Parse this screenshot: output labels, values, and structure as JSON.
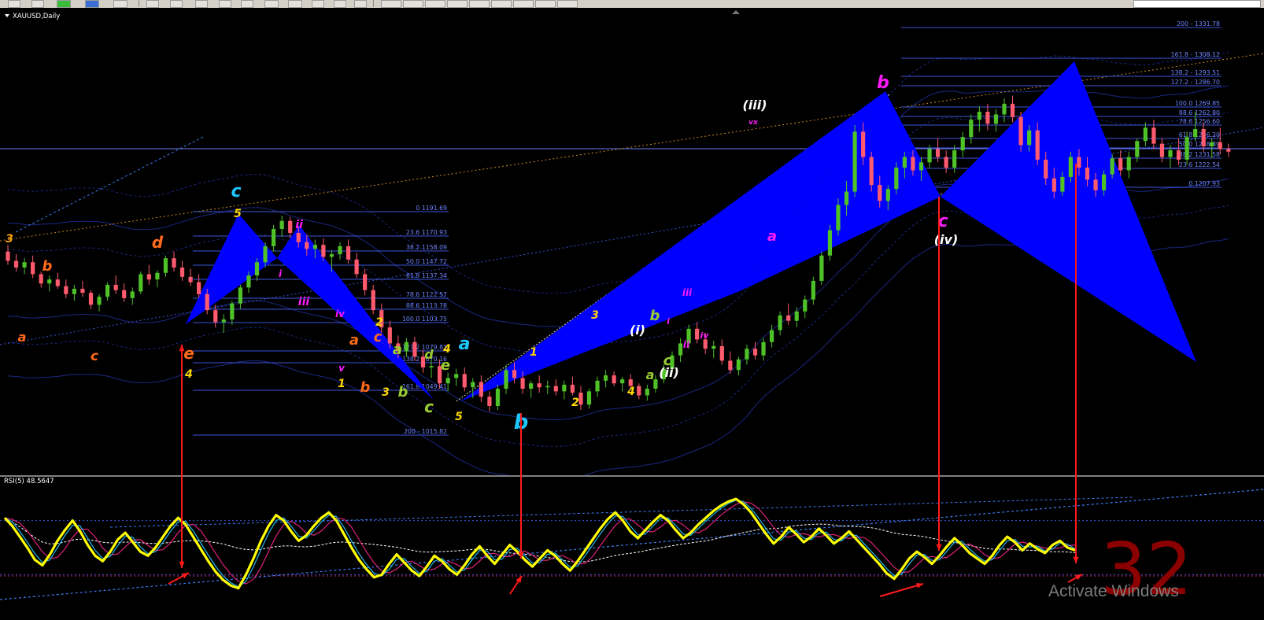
{
  "window": {
    "symbol_title": "XAUUSD,Daily"
  },
  "indicator": {
    "label": "RSI(5) 48.5647"
  },
  "watermark": {
    "text": "Activate Windows"
  },
  "annotation": {
    "count": "32"
  },
  "colors": {
    "background": "#000000",
    "bull": "#4ec227",
    "bear": "#ff5a6e",
    "pattern": "#0000ff",
    "fib": "#3c55d8",
    "rsi": "#ffff00",
    "arrow": "#ff1a1a"
  },
  "fib_left": {
    "levels": [
      {
        "label": "0 1191.69"
      },
      {
        "label": "23.6 1170.93"
      },
      {
        "label": "38.2 1158.09"
      },
      {
        "label": "50.0 1147.72"
      },
      {
        "label": "61.8 1137.34"
      },
      {
        "label": "78.6 1122.57"
      },
      {
        "label": "88.6 1113.78"
      },
      {
        "label": "100.0 1103.75"
      },
      {
        "label": "127.2 1079.83"
      },
      {
        "label": "138.2 1070.16"
      },
      {
        "label": "161.8 1049.41"
      },
      {
        "label": "200 - 1015.82"
      }
    ]
  },
  "fib_right": {
    "levels": [
      {
        "label": "200 - 1331.78"
      },
      {
        "label": "161.8 - 1308.12"
      },
      {
        "label": "138.2 - 1293.51"
      },
      {
        "label": "127.2 - 1286.70"
      },
      {
        "label": "100.0 1269.85"
      },
      {
        "label": "88.6 1262.80"
      },
      {
        "label": "78.6 1256.60"
      },
      {
        "label": "61.8 1246.20"
      },
      {
        "label": "50.0 1238.89"
      },
      {
        "label": "38.2 1231.58"
      },
      {
        "label": "23.6 1222.54"
      },
      {
        "label": "0 1207.93"
      }
    ]
  },
  "wave_labels": [
    {
      "text": "3",
      "color": "#ffa500"
    },
    {
      "text": "a",
      "color": "#ff6a1a"
    },
    {
      "text": "b",
      "color": "#ff6a1a"
    },
    {
      "text": "c",
      "color": "#ff6a1a"
    },
    {
      "text": "d",
      "color": "#ff6a1a"
    },
    {
      "text": "e",
      "color": "#ff6a1a"
    },
    {
      "text": "4",
      "color": "#ffd700"
    },
    {
      "text": "5",
      "color": "#ffd700"
    },
    {
      "text": "c",
      "color": "#1ec8ff"
    },
    {
      "text": "ii",
      "color": "#ff1aff"
    },
    {
      "text": "i",
      "color": "#ff1aff"
    },
    {
      "text": "iii",
      "color": "#ff1aff"
    },
    {
      "text": "iv",
      "color": "#ff1aff"
    },
    {
      "text": "v",
      "color": "#ff1aff"
    },
    {
      "text": "1",
      "color": "#ffd700"
    },
    {
      "text": "2",
      "color": "#ffd700"
    },
    {
      "text": "a",
      "color": "#ff6a1a"
    },
    {
      "text": "b",
      "color": "#ff6a1a"
    },
    {
      "text": "c",
      "color": "#ff6a1a"
    },
    {
      "text": "3",
      "color": "#ffd700"
    },
    {
      "text": "a",
      "color": "#9acd32"
    },
    {
      "text": "b",
      "color": "#9acd32"
    },
    {
      "text": "c",
      "color": "#9acd32"
    },
    {
      "text": "d",
      "color": "#9acd32"
    },
    {
      "text": "e",
      "color": "#9acd32"
    },
    {
      "text": "4",
      "color": "#ffd700"
    },
    {
      "text": "a",
      "color": "#1ec8ff"
    },
    {
      "text": "5",
      "color": "#ffd700"
    },
    {
      "text": "b",
      "color": "#1ec8ff"
    },
    {
      "text": "1",
      "color": "#ffd700"
    },
    {
      "text": "2",
      "color": "#ffd700"
    },
    {
      "text": "3",
      "color": "#ffd700"
    },
    {
      "text": "4",
      "color": "#ffd700"
    },
    {
      "text": "(i)",
      "color": "#ffffff"
    },
    {
      "text": "a",
      "color": "#9acd32"
    },
    {
      "text": "b",
      "color": "#9acd32"
    },
    {
      "text": "c",
      "color": "#9acd32"
    },
    {
      "text": "(ii)",
      "color": "#ffffff"
    },
    {
      "text": "i",
      "color": "#ff1aff"
    },
    {
      "text": "ii",
      "color": "#ff1aff"
    },
    {
      "text": "iii",
      "color": "#ff1aff"
    },
    {
      "text": "iv",
      "color": "#ff1aff"
    },
    {
      "text": "(iii)",
      "color": "#ffffff"
    },
    {
      "text": "vx",
      "color": "#ff1aff"
    },
    {
      "text": "a",
      "color": "#ff1aff"
    },
    {
      "text": "b",
      "color": "#ff1aff"
    },
    {
      "text": "c",
      "color": "#ff1aff"
    },
    {
      "text": "(iv)",
      "color": "#ffffff"
    }
  ],
  "chart_data": {
    "type": "candlestick",
    "title": "XAUUSD,Daily",
    "price_axis": "not shown",
    "candles_ohlc_usd": [
      [
        1165,
        1170,
        1155,
        1158
      ],
      [
        1158,
        1163,
        1150,
        1153
      ],
      [
        1153,
        1160,
        1148,
        1157
      ],
      [
        1157,
        1162,
        1145,
        1148
      ],
      [
        1148,
        1150,
        1138,
        1141
      ],
      [
        1141,
        1147,
        1135,
        1144
      ],
      [
        1144,
        1149,
        1137,
        1139
      ],
      [
        1139,
        1144,
        1130,
        1133
      ],
      [
        1133,
        1140,
        1128,
        1137
      ],
      [
        1137,
        1143,
        1131,
        1134
      ],
      [
        1134,
        1136,
        1122,
        1125
      ],
      [
        1125,
        1133,
        1120,
        1131
      ],
      [
        1131,
        1142,
        1128,
        1140
      ],
      [
        1140,
        1147,
        1133,
        1136
      ],
      [
        1136,
        1141,
        1127,
        1130
      ],
      [
        1130,
        1138,
        1125,
        1135
      ],
      [
        1135,
        1150,
        1133,
        1148
      ],
      [
        1148,
        1155,
        1140,
        1144
      ],
      [
        1144,
        1151,
        1138,
        1149
      ],
      [
        1149,
        1162,
        1146,
        1160
      ],
      [
        1160,
        1165,
        1150,
        1153
      ],
      [
        1153,
        1158,
        1143,
        1146
      ],
      [
        1146,
        1152,
        1139,
        1142
      ],
      [
        1142,
        1148,
        1130,
        1133
      ],
      [
        1133,
        1137,
        1118,
        1121
      ],
      [
        1121,
        1125,
        1108,
        1112
      ],
      [
        1112,
        1118,
        1104,
        1114
      ],
      [
        1114,
        1128,
        1110,
        1126
      ],
      [
        1126,
        1140,
        1122,
        1138
      ],
      [
        1138,
        1150,
        1134,
        1147
      ],
      [
        1147,
        1160,
        1143,
        1157
      ],
      [
        1157,
        1172,
        1153,
        1169
      ],
      [
        1169,
        1185,
        1165,
        1182
      ],
      [
        1182,
        1192,
        1176,
        1188
      ],
      [
        1188,
        1191,
        1175,
        1179
      ],
      [
        1179,
        1184,
        1168,
        1172
      ],
      [
        1172,
        1178,
        1162,
        1167
      ],
      [
        1167,
        1174,
        1160,
        1170
      ],
      [
        1170,
        1175,
        1158,
        1161
      ],
      [
        1161,
        1166,
        1150,
        1163
      ],
      [
        1163,
        1172,
        1159,
        1169
      ],
      [
        1169,
        1174,
        1156,
        1159
      ],
      [
        1159,
        1164,
        1145,
        1148
      ],
      [
        1148,
        1152,
        1132,
        1136
      ],
      [
        1136,
        1140,
        1118,
        1121
      ],
      [
        1121,
        1126,
        1104,
        1108
      ],
      [
        1108,
        1113,
        1092,
        1096
      ],
      [
        1096,
        1102,
        1085,
        1090
      ],
      [
        1090,
        1100,
        1086,
        1097
      ],
      [
        1097,
        1101,
        1083,
        1086
      ],
      [
        1086,
        1091,
        1074,
        1078
      ],
      [
        1078,
        1083,
        1070,
        1079
      ],
      [
        1079,
        1084,
        1062,
        1066
      ],
      [
        1066,
        1074,
        1060,
        1070
      ],
      [
        1070,
        1077,
        1064,
        1073
      ],
      [
        1073,
        1078,
        1060,
        1063
      ],
      [
        1063,
        1070,
        1055,
        1067
      ],
      [
        1067,
        1072,
        1052,
        1056
      ],
      [
        1056,
        1060,
        1045,
        1049
      ],
      [
        1049,
        1065,
        1046,
        1062
      ],
      [
        1062,
        1080,
        1058,
        1076
      ],
      [
        1076,
        1082,
        1066,
        1070
      ],
      [
        1070,
        1075,
        1058,
        1062
      ],
      [
        1062,
        1068,
        1055,
        1066
      ],
      [
        1066,
        1072,
        1059,
        1063
      ],
      [
        1063,
        1068,
        1058,
        1064
      ],
      [
        1064,
        1069,
        1057,
        1060
      ],
      [
        1060,
        1068,
        1054,
        1065
      ],
      [
        1065,
        1071,
        1057,
        1059
      ],
      [
        1059,
        1064,
        1046,
        1050
      ],
      [
        1050,
        1062,
        1047,
        1060
      ],
      [
        1060,
        1071,
        1056,
        1068
      ],
      [
        1068,
        1076,
        1063,
        1072
      ],
      [
        1072,
        1075,
        1064,
        1066
      ],
      [
        1066,
        1071,
        1060,
        1069
      ],
      [
        1069,
        1073,
        1062,
        1064
      ],
      [
        1064,
        1066,
        1054,
        1057
      ],
      [
        1057,
        1065,
        1053,
        1062
      ],
      [
        1062,
        1072,
        1059,
        1069
      ],
      [
        1069,
        1080,
        1066,
        1077
      ],
      [
        1077,
        1090,
        1074,
        1087
      ],
      [
        1087,
        1100,
        1082,
        1096
      ],
      [
        1096,
        1110,
        1092,
        1107
      ],
      [
        1107,
        1112,
        1096,
        1099
      ],
      [
        1099,
        1104,
        1088,
        1092
      ],
      [
        1092,
        1098,
        1085,
        1094
      ],
      [
        1094,
        1099,
        1080,
        1083
      ],
      [
        1083,
        1090,
        1073,
        1076
      ],
      [
        1076,
        1086,
        1072,
        1084
      ],
      [
        1084,
        1095,
        1080,
        1092
      ],
      [
        1092,
        1097,
        1084,
        1087
      ],
      [
        1087,
        1100,
        1083,
        1097
      ],
      [
        1097,
        1110,
        1093,
        1106
      ],
      [
        1106,
        1120,
        1102,
        1117
      ],
      [
        1117,
        1126,
        1110,
        1113
      ],
      [
        1113,
        1123,
        1108,
        1120
      ],
      [
        1120,
        1132,
        1115,
        1129
      ],
      [
        1129,
        1146,
        1125,
        1143
      ],
      [
        1143,
        1165,
        1140,
        1162
      ],
      [
        1162,
        1185,
        1158,
        1181
      ],
      [
        1181,
        1205,
        1177,
        1200
      ],
      [
        1200,
        1218,
        1192,
        1210
      ],
      [
        1210,
        1260,
        1206,
        1255
      ],
      [
        1255,
        1262,
        1230,
        1236
      ],
      [
        1236,
        1240,
        1210,
        1215
      ],
      [
        1215,
        1222,
        1198,
        1203
      ],
      [
        1203,
        1215,
        1196,
        1212
      ],
      [
        1212,
        1232,
        1208,
        1228
      ],
      [
        1228,
        1240,
        1220,
        1236
      ],
      [
        1236,
        1241,
        1222,
        1226
      ],
      [
        1226,
        1236,
        1218,
        1232
      ],
      [
        1232,
        1245,
        1228,
        1242
      ],
      [
        1242,
        1250,
        1232,
        1236
      ],
      [
        1236,
        1241,
        1224,
        1228
      ],
      [
        1228,
        1245,
        1224,
        1241
      ],
      [
        1241,
        1255,
        1236,
        1251
      ],
      [
        1251,
        1268,
        1246,
        1264
      ],
      [
        1264,
        1274,
        1255,
        1270
      ],
      [
        1270,
        1276,
        1256,
        1261
      ],
      [
        1261,
        1272,
        1255,
        1268
      ],
      [
        1268,
        1280,
        1262,
        1276
      ],
      [
        1276,
        1282,
        1262,
        1266
      ],
      [
        1266,
        1270,
        1240,
        1245
      ],
      [
        1245,
        1260,
        1240,
        1256
      ],
      [
        1256,
        1262,
        1230,
        1234
      ],
      [
        1234,
        1240,
        1215,
        1220
      ],
      [
        1220,
        1228,
        1205,
        1210
      ],
      [
        1210,
        1225,
        1207,
        1221
      ],
      [
        1221,
        1240,
        1217,
        1236
      ],
      [
        1236,
        1242,
        1222,
        1228
      ],
      [
        1228,
        1236,
        1214,
        1219
      ],
      [
        1219,
        1224,
        1206,
        1211
      ],
      [
        1211,
        1226,
        1207,
        1223
      ],
      [
        1223,
        1238,
        1220,
        1235
      ],
      [
        1235,
        1241,
        1222,
        1226
      ],
      [
        1226,
        1240,
        1220,
        1236
      ],
      [
        1236,
        1250,
        1232,
        1248
      ],
      [
        1248,
        1262,
        1244,
        1258
      ],
      [
        1258,
        1264,
        1242,
        1246
      ],
      [
        1246,
        1250,
        1232,
        1236
      ],
      [
        1236,
        1245,
        1228,
        1241
      ],
      [
        1241,
        1250,
        1230,
        1234
      ],
      [
        1234,
        1255,
        1230,
        1251
      ],
      [
        1251,
        1270,
        1248,
        1257
      ],
      [
        1257,
        1262,
        1240,
        1244
      ],
      [
        1244,
        1250,
        1235,
        1247
      ],
      [
        1247,
        1258,
        1238,
        1242
      ],
      [
        1242,
        1246,
        1236,
        1240
      ]
    ],
    "rsi": {
      "label": "RSI(5) 48.5647",
      "range": [
        0,
        100
      ],
      "values": [
        72,
        66,
        58,
        50,
        41,
        37,
        45,
        55,
        63,
        70,
        62,
        52,
        44,
        40,
        47,
        56,
        61,
        54,
        47,
        44,
        50,
        58,
        66,
        72,
        67,
        58,
        49,
        40,
        32,
        26,
        22,
        20,
        30,
        42,
        55,
        66,
        74,
        70,
        62,
        55,
        59,
        66,
        72,
        76,
        70,
        60,
        50,
        41,
        34,
        28,
        30,
        38,
        45,
        39,
        33,
        29,
        36,
        44,
        40,
        34,
        30,
        37,
        45,
        51,
        44,
        38,
        45,
        52,
        47,
        41,
        36,
        42,
        48,
        44,
        38,
        33,
        40,
        48,
        56,
        64,
        71,
        76,
        70,
        62,
        57,
        63,
        69,
        74,
        70,
        63,
        57,
        61,
        67,
        72,
        77,
        81,
        84,
        86,
        82,
        76,
        68,
        60,
        53,
        58,
        65,
        60,
        54,
        58,
        64,
        59,
        53,
        57,
        62,
        56,
        50,
        44,
        38,
        31,
        27,
        34,
        42,
        47,
        43,
        38,
        44,
        51,
        57,
        52,
        46,
        42,
        38,
        44,
        52,
        58,
        54,
        48,
        53,
        49,
        46,
        52,
        55,
        50,
        48
      ]
    },
    "rsi_level_lines": [
      70,
      30
    ],
    "fibonacci_retracements": [
      {
        "levels_pct": [
          0,
          23.6,
          38.2,
          50.0,
          61.8,
          78.6,
          88.6,
          100.0,
          127.2,
          138.2,
          161.8,
          200
        ],
        "prices": [
          1191.69,
          1170.93,
          1158.09,
          1147.72,
          1137.34,
          1122.57,
          1113.78,
          1103.75,
          1079.83,
          1070.16,
          1049.41,
          1015.82
        ]
      },
      {
        "levels_pct": [
          200,
          161.8,
          138.2,
          127.2,
          100.0,
          88.6,
          78.6,
          61.8,
          50.0,
          38.2,
          23.6,
          0
        ],
        "prices": [
          1331.78,
          1308.12,
          1293.51,
          1286.7,
          1269.85,
          1262.8,
          1256.6,
          1246.2,
          1238.89,
          1231.58,
          1222.54,
          1207.93
        ]
      }
    ],
    "harmonic_patterns": 4,
    "grid": false
  }
}
